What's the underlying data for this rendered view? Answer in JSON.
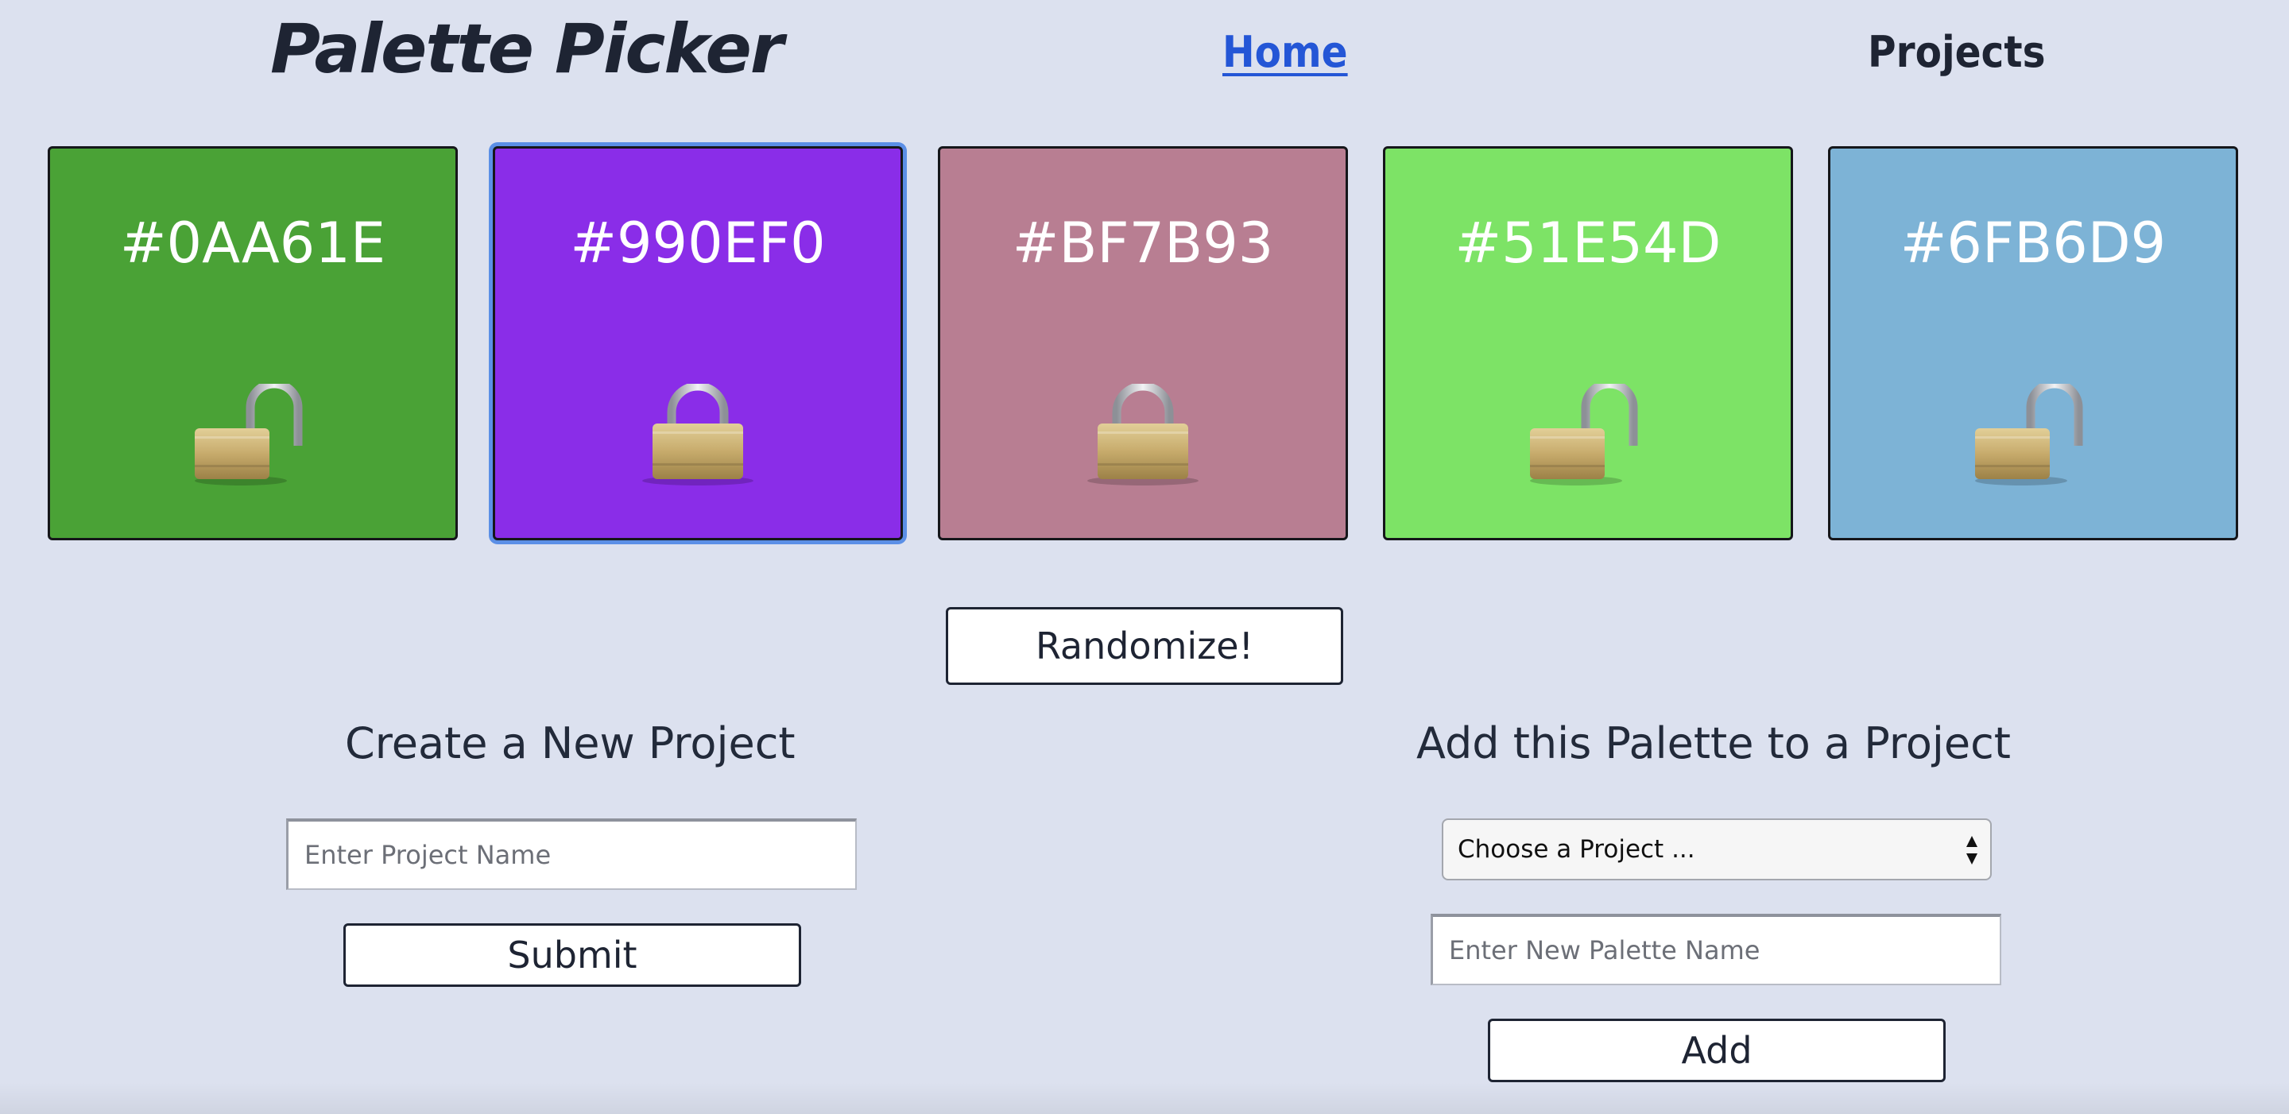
{
  "header": {
    "logo": "Palette Picker",
    "nav": {
      "home": "Home",
      "projects": "Projects"
    }
  },
  "swatches": [
    {
      "hex": "#0AA61E",
      "color": "#4aa236",
      "locked": false,
      "icon": "unlocked-padlock-icon"
    },
    {
      "hex": "#990EF0",
      "color": "#8a2de8",
      "locked": true,
      "icon": "locked-padlock-icon"
    },
    {
      "hex": "#BF7B93",
      "color": "#b87e92",
      "locked": true,
      "icon": "locked-padlock-icon"
    },
    {
      "hex": "#51E54D",
      "color": "#7de366",
      "locked": false,
      "icon": "unlocked-padlock-icon"
    },
    {
      "hex": "#6FB6D9",
      "color": "#7db3d6",
      "locked": false,
      "icon": "unlocked-padlock-icon"
    }
  ],
  "controls": {
    "randomize_label": "Randomize!"
  },
  "create_project": {
    "title": "Create a New Project",
    "input_placeholder": "Enter Project Name",
    "submit_label": "Submit"
  },
  "add_palette": {
    "title": "Add this Palette to a Project",
    "select_value": "Choose a Project ...",
    "input_placeholder": "Enter New Palette Name",
    "add_label": "Add"
  },
  "colors": {
    "background": "#dce1ef",
    "text": "#222a3a",
    "link": "#2456d6",
    "selection_ring": "#5b8fe6"
  }
}
